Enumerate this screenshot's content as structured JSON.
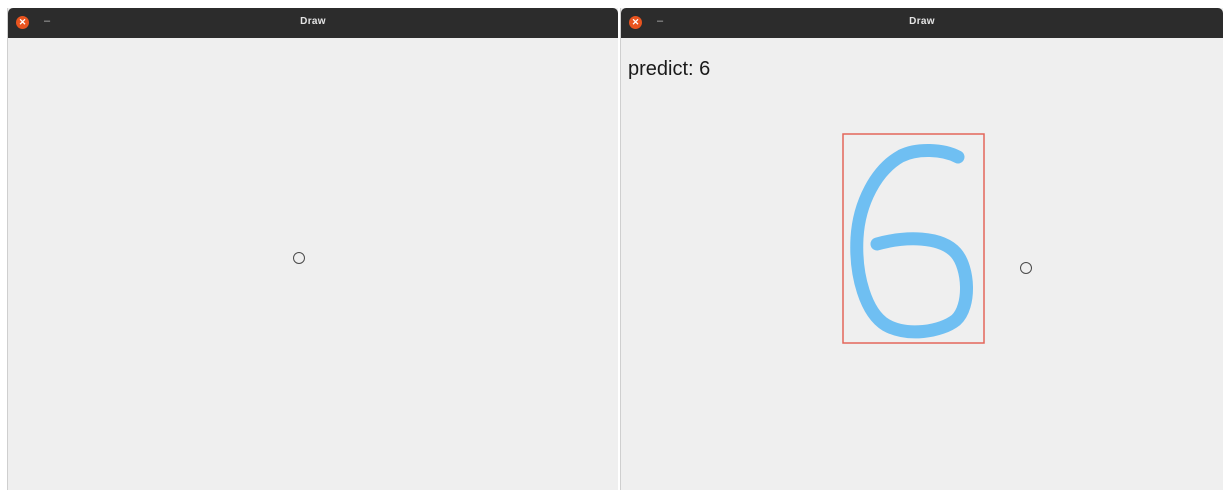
{
  "windows": [
    {
      "title": "Draw",
      "close_glyph": "✕",
      "minimize_glyph": "–"
    },
    {
      "title": "Draw",
      "close_glyph": "✕",
      "minimize_glyph": "–",
      "predict_label": "predict: 6"
    }
  ],
  "colors": {
    "stroke": "#6fbff2",
    "bounding_box": "#e4665a",
    "titlebar": "#2c2c2c",
    "canvas": "#efefef",
    "close_button": "#e9541f"
  },
  "icons": {
    "close": "close-icon",
    "minimize": "minimize-icon",
    "cursor": "cursor-circle-icon"
  }
}
